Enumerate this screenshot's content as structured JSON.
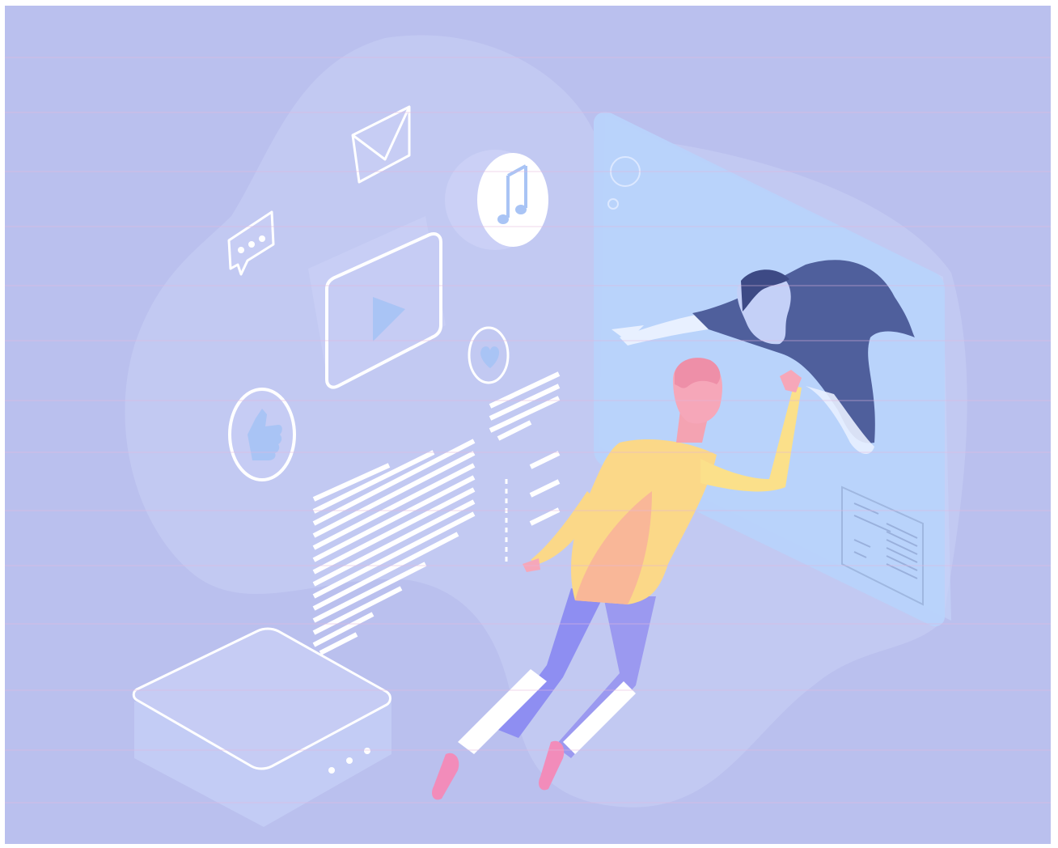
{
  "scene": {
    "background_color": "#bac0ee",
    "blob_color": "#c4cbf3",
    "screen_color": "#b8d3fb",
    "outline_color": "#ffffff",
    "accent_blue": "#a9c4f5",
    "shirt_color": "#fbe58a",
    "pants_color": "#8e8ef2",
    "hair_color": "#f6a7b9",
    "scanline_color": "#e4b7dc",
    "icons": [
      "envelope-icon",
      "chat-bubble-icon",
      "music-note-icon",
      "video-play-icon",
      "thumbs-up-icon",
      "heart-icon"
    ]
  }
}
